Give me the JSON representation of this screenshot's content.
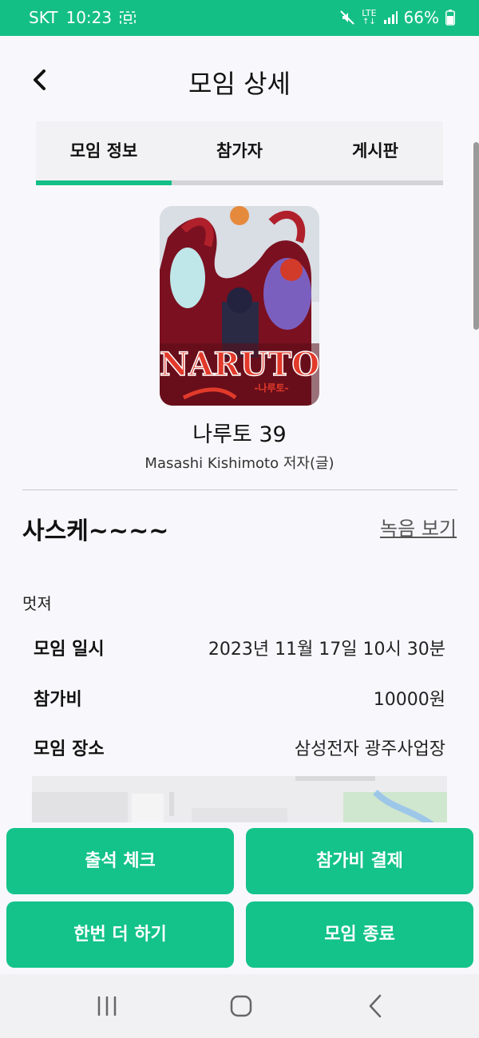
{
  "status_bar": {
    "carrier": "SKT",
    "time": "10:23",
    "network": "LTE",
    "battery": "66%",
    "icons": [
      "screenshot-icon",
      "mute-icon",
      "lte-icon",
      "signal-icon",
      "battery-icon"
    ]
  },
  "header": {
    "title": "모임 상세",
    "back_icon": "chevron-left-icon"
  },
  "tabs": [
    {
      "label": "모임 정보",
      "active": true
    },
    {
      "label": "참가자",
      "active": false
    },
    {
      "label": "게시판",
      "active": false
    }
  ],
  "book": {
    "title": "나루토 39",
    "author": "Masashi Kishimoto 저자(글)",
    "cover_text": "NARUTO",
    "cover_subtext": "-나루토-"
  },
  "meeting": {
    "title": "사스케~~~~",
    "record_link": "녹음 보기",
    "description": "멋져",
    "details": [
      {
        "label": "모임 일시",
        "value": "2023년 11월 17일 10시 30분"
      },
      {
        "label": "참가비",
        "value": "10000원"
      },
      {
        "label": "모임 장소",
        "value": "삼성전자 광주사업장"
      }
    ]
  },
  "actions": [
    {
      "label": "출석 체크"
    },
    {
      "label": "참가비 결제"
    },
    {
      "label": "한번 더 하기"
    },
    {
      "label": "모임 종료"
    }
  ],
  "colors": {
    "accent": "#14bf85",
    "button": "#14c389",
    "background": "#f8f8fc"
  },
  "nav_bar": {
    "icons": [
      "recent-apps-icon",
      "home-icon",
      "back-icon"
    ]
  }
}
